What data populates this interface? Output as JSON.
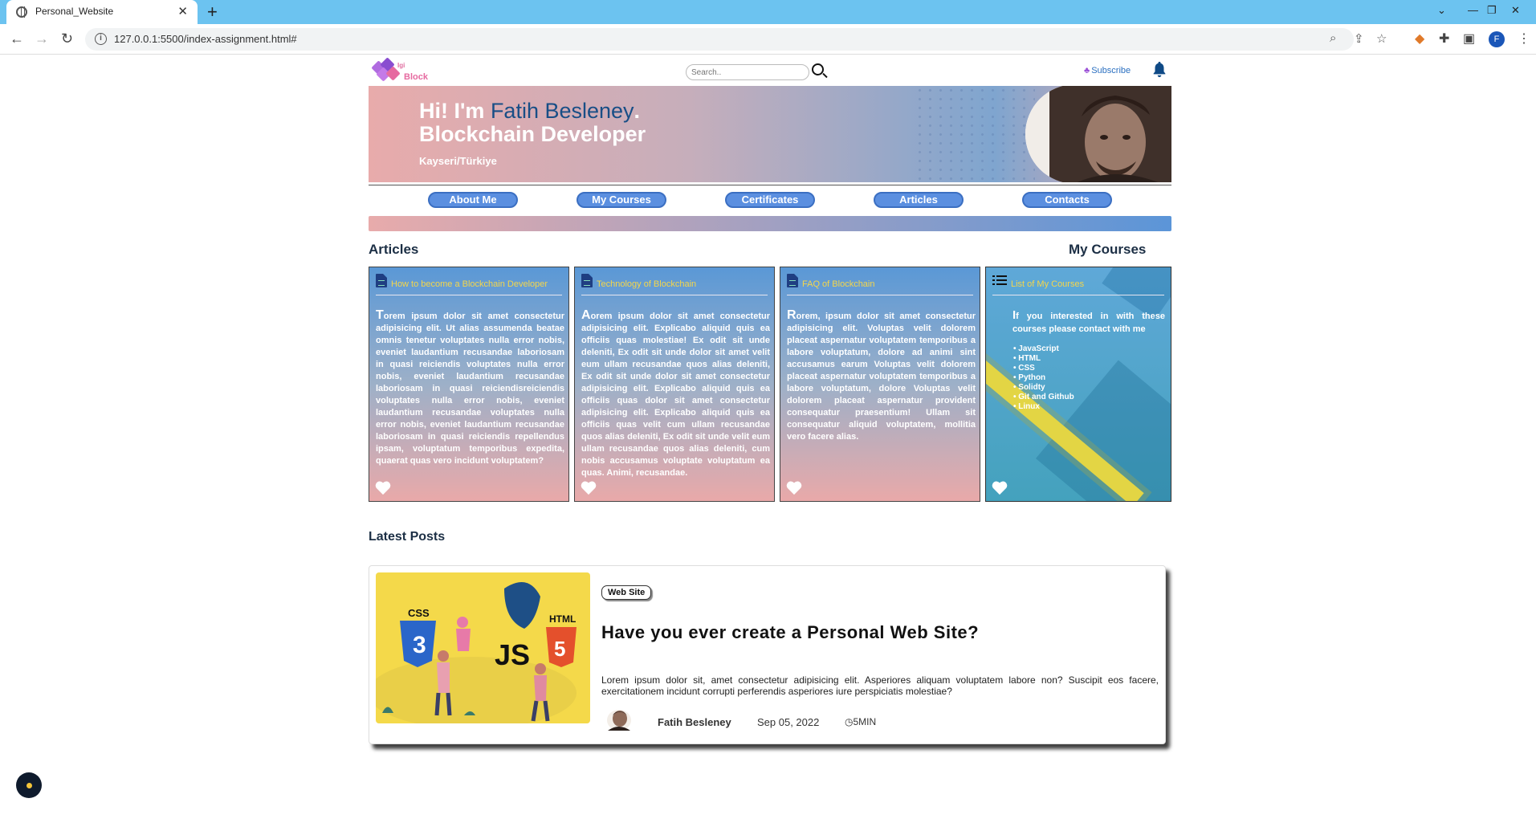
{
  "browser": {
    "tab_title": "Personal_Website",
    "tab_close": "✕",
    "new_tab": "+",
    "url": "127.0.0.1:5500/index-assignment.html#",
    "profile_initial": "F"
  },
  "header": {
    "logo_small_text": "Igi",
    "logo_text": "Block",
    "search_placeholder": "Search..",
    "subscribe_label": "Subscribe"
  },
  "hero": {
    "greeting": "Hi! I'm",
    "name": "Fatih Besleney",
    "name_dot": ".",
    "role": "Blockchain Developer",
    "location": "Kayseri/Türkiye"
  },
  "nav": {
    "items": [
      "About Me",
      "My Courses",
      "Certificates",
      "Articles",
      "Contacts"
    ]
  },
  "articles": {
    "section_title": "Articles",
    "cards": [
      {
        "title": "How to become a Blockchain Developer",
        "drop": "T",
        "body": "orem ipsum dolor sit amet consectetur adipisicing elit. Ut alias assumenda beatae omnis tenetur voluptates nulla error nobis, eveniet laudantium recusandae laboriosam in quasi reiciendis voluptates nulla error nobis, eveniet laudantium recusandae laboriosam in quasi reiciendisreiciendis voluptates nulla error nobis, eveniet laudantium recusandae voluptates nulla error nobis, eveniet laudantium recusandae laboriosam in quasi reiciendis repellendus ipsam, voluptatum temporibus expedita, quaerat quas vero incidunt voluptatem?"
      },
      {
        "title": "Technology of Blockchain",
        "drop": "A",
        "body": "orem ipsum dolor sit amet consectetur adipisicing elit. Explicabo aliquid quis ea officiis quas molestiae! Ex odit sit unde deleniti, Ex odit sit unde dolor sit amet velit eum ullam recusandae quos alias deleniti, Ex odit sit unde dolor sit amet consectetur adipisicing elit. Explicabo aliquid quis ea officiis quas dolor sit amet consectetur adipisicing elit. Explicabo aliquid quis ea officiis quas velit cum ullam recusandae quos alias deleniti, Ex odit sit unde velit eum ullam recusandae quos alias deleniti, cum nobis accusamus voluptate voluptatum ea quas. Animi, recusandae."
      },
      {
        "title": "FAQ of Blockchain",
        "drop": "R",
        "body": "orem, ipsum dolor sit amet consectetur adipisicing elit. Voluptas velit dolorem placeat aspernatur voluptatem temporibus a labore voluptatum, dolore ad animi sint accusamus earum Voluptas velit dolorem placeat aspernatur voluptatem temporibus a labore voluptatum, dolore Voluptas velit dolorem placeat aspernatur provident consequatur praesentium! Ullam sit consequatur aliquid voluptatem, mollitia vero facere alias."
      }
    ]
  },
  "courses": {
    "section_title": "My Courses",
    "card_title": "List of My Courses",
    "intro_drop": "I",
    "intro": "f you interested in with these courses please contact with me",
    "items": [
      "JavaScript",
      "HTML",
      "CSS",
      "Python",
      "Solidty",
      "Git and Github",
      "Linux"
    ]
  },
  "latest": {
    "section_title": "Latest Posts",
    "post": {
      "tag": "Web Site",
      "title": "Have you ever create a Personal Web Site?",
      "excerpt": "Lorem ipsum dolor sit, amet consectetur adipisicing elit. Asperiores aliquam voluptatem labore non? Suscipit eos facere, exercitationem incidunt corrupti perferendis asperiores iure perspiciatis molestiae?",
      "author": "Fatih Besleney",
      "date": "Sep 05, 2022",
      "read_time": "5MIN",
      "image_labels": {
        "css": "CSS",
        "js": "JS",
        "html": "HTML"
      }
    }
  },
  "colors": {
    "browser_tabbar": "#6cc3f0",
    "nav_button": "#5b8fe0",
    "card_title": "#f5d64a",
    "hero_name": "#184e86"
  }
}
